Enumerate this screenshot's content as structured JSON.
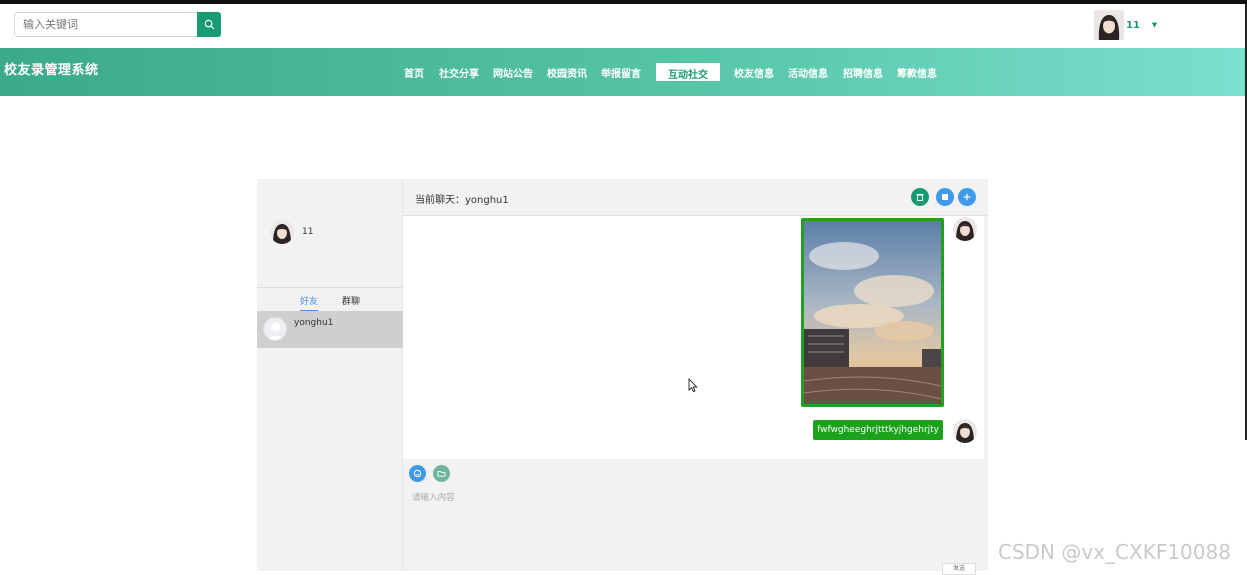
{
  "search": {
    "placeholder": "输入关键词",
    "icon": "search-icon"
  },
  "user": {
    "name": "11"
  },
  "brand": {
    "title": "校友录管理系统"
  },
  "nav": {
    "items": [
      "首页",
      "社交分享",
      "网站公告",
      "校园资讯",
      "举报留言",
      "互动社交",
      "校友信息",
      "活动信息",
      "招聘信息",
      "筹款信息"
    ],
    "active": "互动社交"
  },
  "chat": {
    "title": "当前聊天：yonghu1",
    "me_name": "11",
    "tabs": [
      "好友",
      "群聊"
    ],
    "friends": [
      "yonghu1"
    ],
    "messages": [
      {
        "type": "image",
        "description": "campus sky photo"
      },
      {
        "type": "text",
        "text": "fwfwgheeghrjtttkyjhgehrjty"
      }
    ],
    "composer_placeholder": "请输入内容",
    "send_label": "发送"
  },
  "colors": {
    "accent": "#1a9a72",
    "bubble": "#1aa31a",
    "blue": "#3f9ae8"
  },
  "watermark": "CSDN @vx_CXKF10088"
}
